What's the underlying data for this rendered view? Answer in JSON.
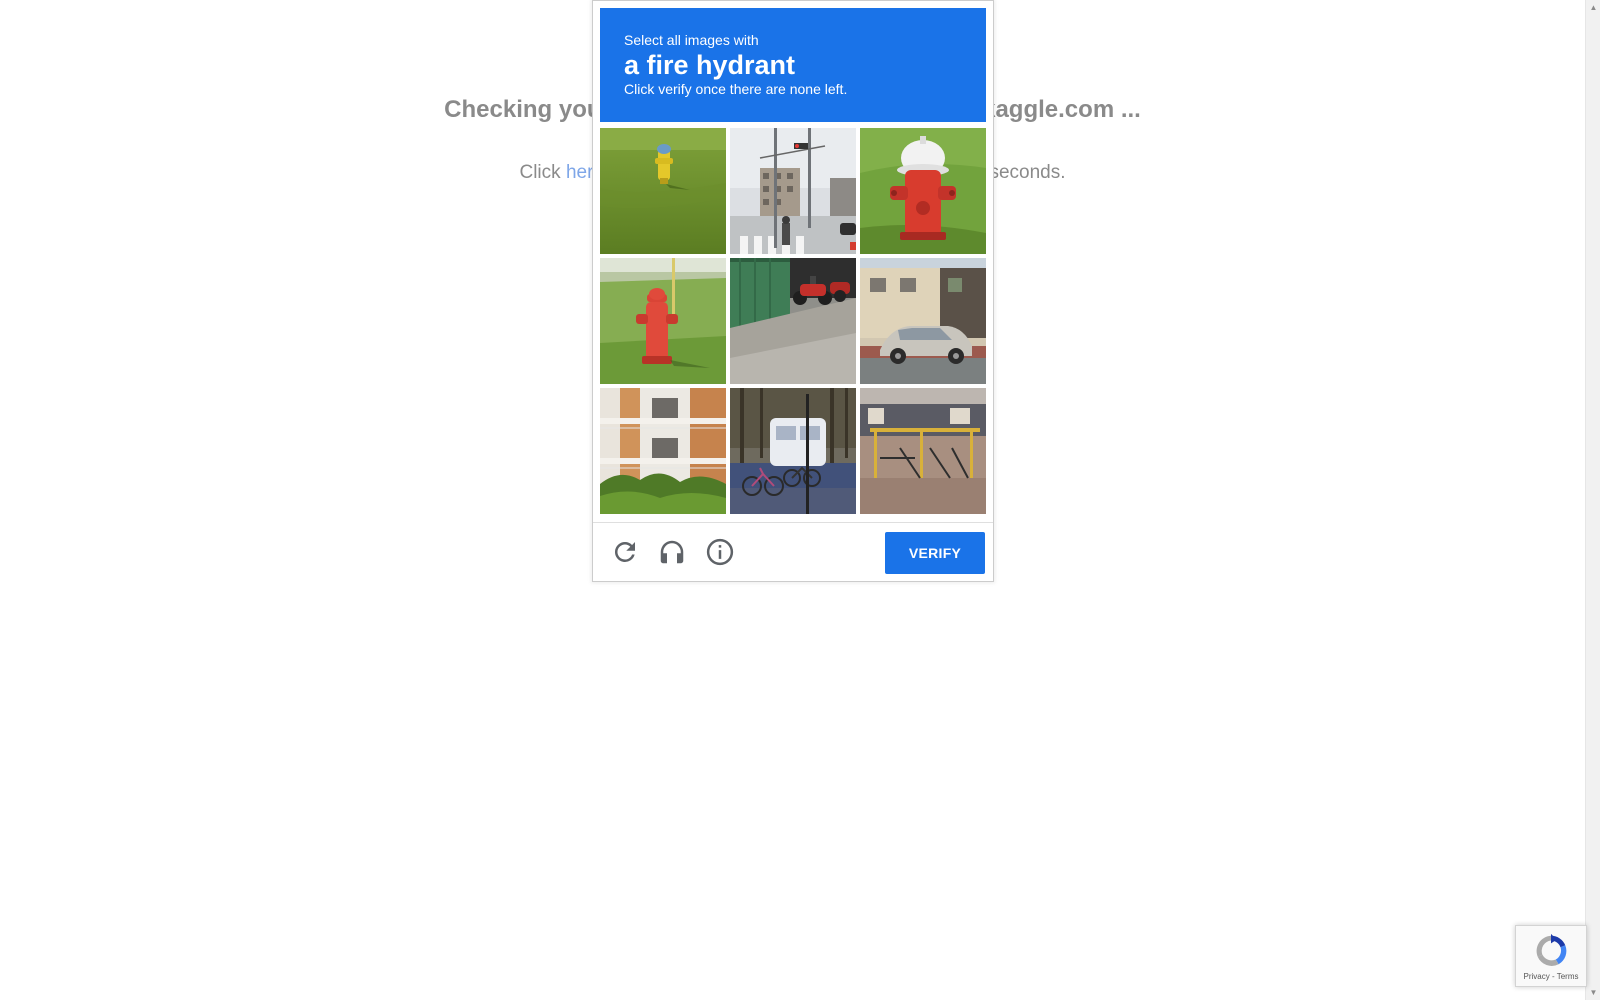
{
  "background": {
    "heading": "Checking your browser before accessing www.kaggle.com ...",
    "sub_prefix": "Click ",
    "sub_link": "here",
    "sub_suffix": " if you are not automatically redirected after 5 seconds."
  },
  "captcha": {
    "instruction": "Select all images with",
    "target": "a fire hydrant",
    "hint": "Click verify once there are none left.",
    "tiles": [
      {
        "subject": "yellow fire hydrant on grass"
      },
      {
        "subject": "street crossing with traffic light"
      },
      {
        "subject": "red fire hydrant on grass"
      },
      {
        "subject": "red fire hydrant on lawn"
      },
      {
        "subject": "parked motorcycles by garage"
      },
      {
        "subject": "silver car in front of house"
      },
      {
        "subject": "apartment building balconies"
      },
      {
        "subject": "bicycles parked near vehicle"
      },
      {
        "subject": "playground structure by building"
      }
    ],
    "footer": {
      "reload_icon": "reload-icon",
      "audio_icon": "headphones-icon",
      "info_icon": "info-icon",
      "verify_label": "VERIFY"
    },
    "colors": {
      "accent": "#1a73e8",
      "header_text": "#ffffff"
    }
  },
  "badge": {
    "links": "Privacy - Terms"
  }
}
